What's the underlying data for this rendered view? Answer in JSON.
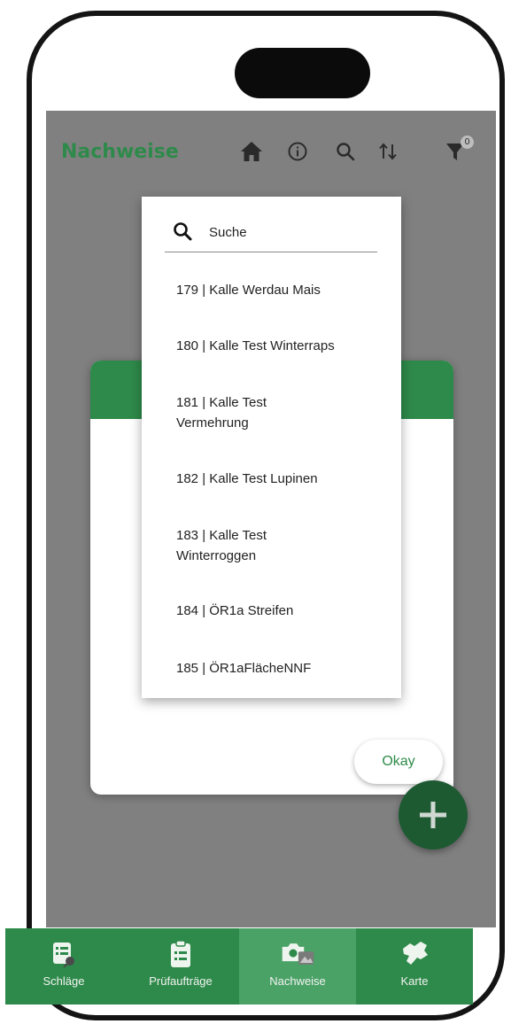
{
  "app": {
    "title": "Nachweise",
    "filter_count": "0",
    "accent_color": "#2e8a4a"
  },
  "appbar_icons": [
    "home-icon",
    "info-icon",
    "search-icon",
    "sort-icon",
    "filter-icon"
  ],
  "dropdown": {
    "search_placeholder": "Suche",
    "options": [
      {
        "id": "179",
        "line1": "179 | Kalle Werdau Mais",
        "line2": ""
      },
      {
        "id": "180",
        "line1": "180 | Kalle Test Winterraps",
        "line2": ""
      },
      {
        "id": "181",
        "line1": "181 | Kalle Test",
        "line2": "Vermehrung"
      },
      {
        "id": "182",
        "line1": "182 | Kalle Test Lupinen",
        "line2": ""
      },
      {
        "id": "183",
        "line1": "183 | Kalle Test",
        "line2": "Winterroggen"
      },
      {
        "id": "184",
        "line1": "184 | ÖR1a Streifen",
        "line2": ""
      },
      {
        "id": "185",
        "line1": "185 | ÖR1aFlächeNNF",
        "line2": ""
      }
    ]
  },
  "dialog": {
    "okay_label": "Okay"
  },
  "bottom_nav": [
    {
      "label": "Schläge",
      "icon": "fields-list-icon",
      "active": false
    },
    {
      "label": "Prüfaufträge",
      "icon": "clipboard-icon",
      "active": false
    },
    {
      "label": "Nachweise",
      "icon": "camera-photo-icon",
      "active": true
    },
    {
      "label": "Karte",
      "icon": "map-icon",
      "active": false
    }
  ]
}
